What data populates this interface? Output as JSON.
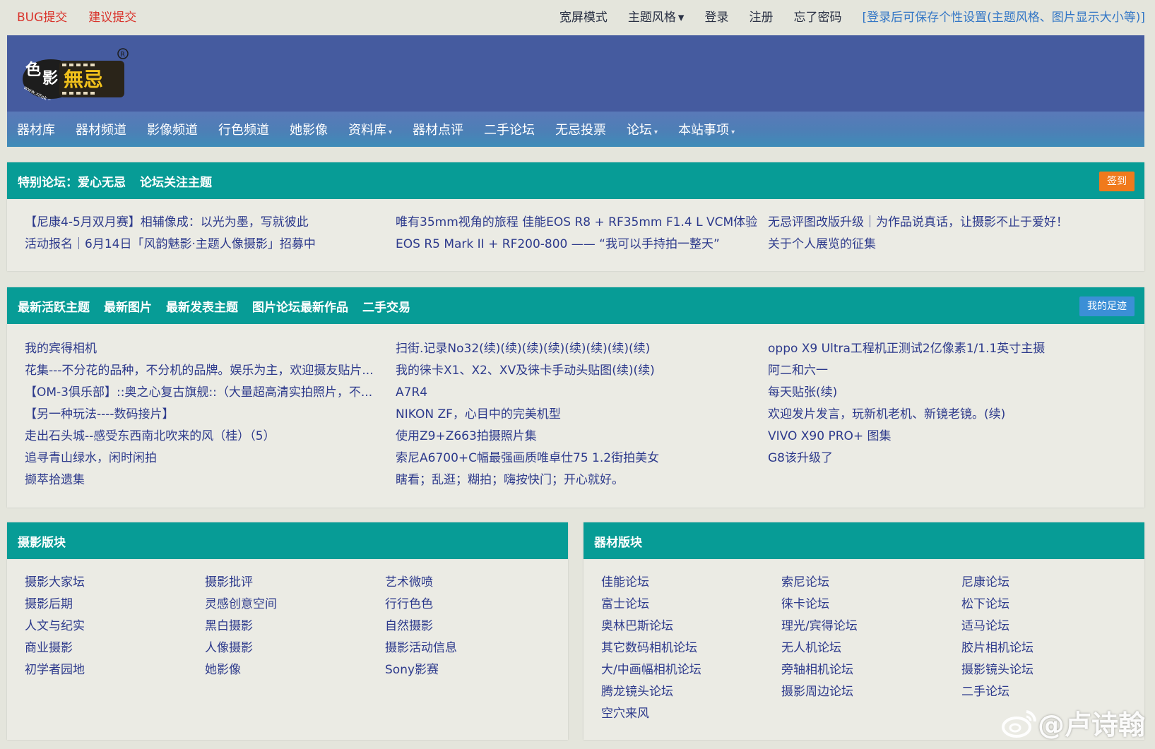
{
  "topbar": {
    "left": [
      "BUG提交",
      "建议提交"
    ],
    "wide_mode": "宽屏模式",
    "theme": "主题风格",
    "login": "登录",
    "register": "注册",
    "forgot": "忘了密码",
    "hint": "[登录后可保存个性设置(主题风格、图片显示大小等)]"
  },
  "nav": {
    "items": [
      {
        "label": "器材库",
        "dropdown": false
      },
      {
        "label": "器材频道",
        "dropdown": false
      },
      {
        "label": "影像频道",
        "dropdown": false
      },
      {
        "label": "行色频道",
        "dropdown": false
      },
      {
        "label": "她影像",
        "dropdown": false
      },
      {
        "label": "资料库",
        "dropdown": true
      },
      {
        "label": "器材点评",
        "dropdown": false
      },
      {
        "label": "二手论坛",
        "dropdown": false
      },
      {
        "label": "无忌投票",
        "dropdown": false
      },
      {
        "label": "论坛",
        "dropdown": true
      },
      {
        "label": "本站事项",
        "dropdown": true
      }
    ]
  },
  "logo": {
    "text1": "色",
    "text2": "影",
    "text3": "無忌",
    "url": "www.xitek.com",
    "reg": "R"
  },
  "special": {
    "tabs": [
      "特别论坛：爱心无忌",
      "论坛关注主题"
    ],
    "button": "签到",
    "columns": [
      [
        "【尼康4-5月双月赛】相辅像成：以光为墨，写就彼此",
        "活动报名｜6月14日「风韵魅影·主题人像摄影」招募中"
      ],
      [
        "唯有35mm视角的旅程 佳能EOS R8 + RF35mm F1.4 L VCM体验",
        "EOS R5 Mark II + RF200-800 —— “我可以手持拍一整天”"
      ],
      [
        "无忌评图改版升级｜为作品说真话，让摄影不止于爱好！",
        "关于个人展览的征集"
      ]
    ]
  },
  "latest": {
    "tabs": [
      "最新活跃主题",
      "最新图片",
      "最新发表主题",
      "图片论坛最新作品",
      "二手交易"
    ],
    "button": "我的足迹",
    "columns": [
      [
        "我的宾得相机",
        "花集---不分花的品种，不分机的品牌。娱乐为主，欢迎摄友贴片...",
        "【OM-3俱乐部】::奥之心复古旗舰::（大量超高清实拍照片，不...",
        "【另一种玩法----数码接片】",
        "走出石头城--感受东西南北吹来的风（桂）（5）",
        "追寻青山绿水，闲时闲拍",
        "撷萃拾遗集"
      ],
      [
        "扫街.记录No32(续)(续)(续)(续)(续)(续)(续)(续)",
        "我的徕卡X1、X2、XV及徕卡手动头贴图(续)(续)",
        "A7R4",
        "NIKON ZF，心目中的完美机型",
        "使用Z9+Z663拍摄照片集",
        "索尼A6700+C幅最强画质唯卓仕75 1.2街拍美女",
        "瞎看；乱逛；糊拍；嗨按快门；开心就好。"
      ],
      [
        "oppo X9 Ultra工程机正测试2亿像素1/1.1英寸主摄",
        "阿二和六一",
        "每天贴张(续)",
        "欢迎发片发言，玩新机老机、新镜老镜。(续)",
        "VIVO X90 PRO+ 图集",
        "G8该升级了"
      ]
    ]
  },
  "photo_section": {
    "title": "摄影版块",
    "columns": [
      [
        "摄影大家坛",
        "摄影后期",
        "人文与纪实",
        "商业摄影",
        "初学者园地"
      ],
      [
        "摄影批评",
        "灵感创意空间",
        "黑白摄影",
        "人像摄影",
        "她影像"
      ],
      [
        "艺术微喷",
        "行行色色",
        "自然摄影",
        "摄影活动信息",
        "Sony影赛"
      ]
    ]
  },
  "gear_section": {
    "title": "器材版块",
    "columns": [
      [
        "佳能论坛",
        "富士论坛",
        "奥林巴斯论坛",
        "其它数码相机论坛",
        "大/中画幅相机论坛",
        "腾龙镜头论坛",
        "空穴来风"
      ],
      [
        "索尼论坛",
        "徕卡论坛",
        "理光/宾得论坛",
        "无人机论坛",
        "旁轴相机论坛",
        "摄影周边论坛"
      ],
      [
        "尼康论坛",
        "松下论坛",
        "适马论坛",
        "胶片相机论坛",
        "摄影镜头论坛",
        "二手论坛"
      ]
    ]
  },
  "watermark": "@卢诗翰",
  "colors": {
    "teal": "#079c96",
    "header": "#455b9f",
    "link": "#2d3a8c",
    "red": "#d9332b",
    "orange": "#f07a1c",
    "blue_btn": "#3b8fd6"
  }
}
